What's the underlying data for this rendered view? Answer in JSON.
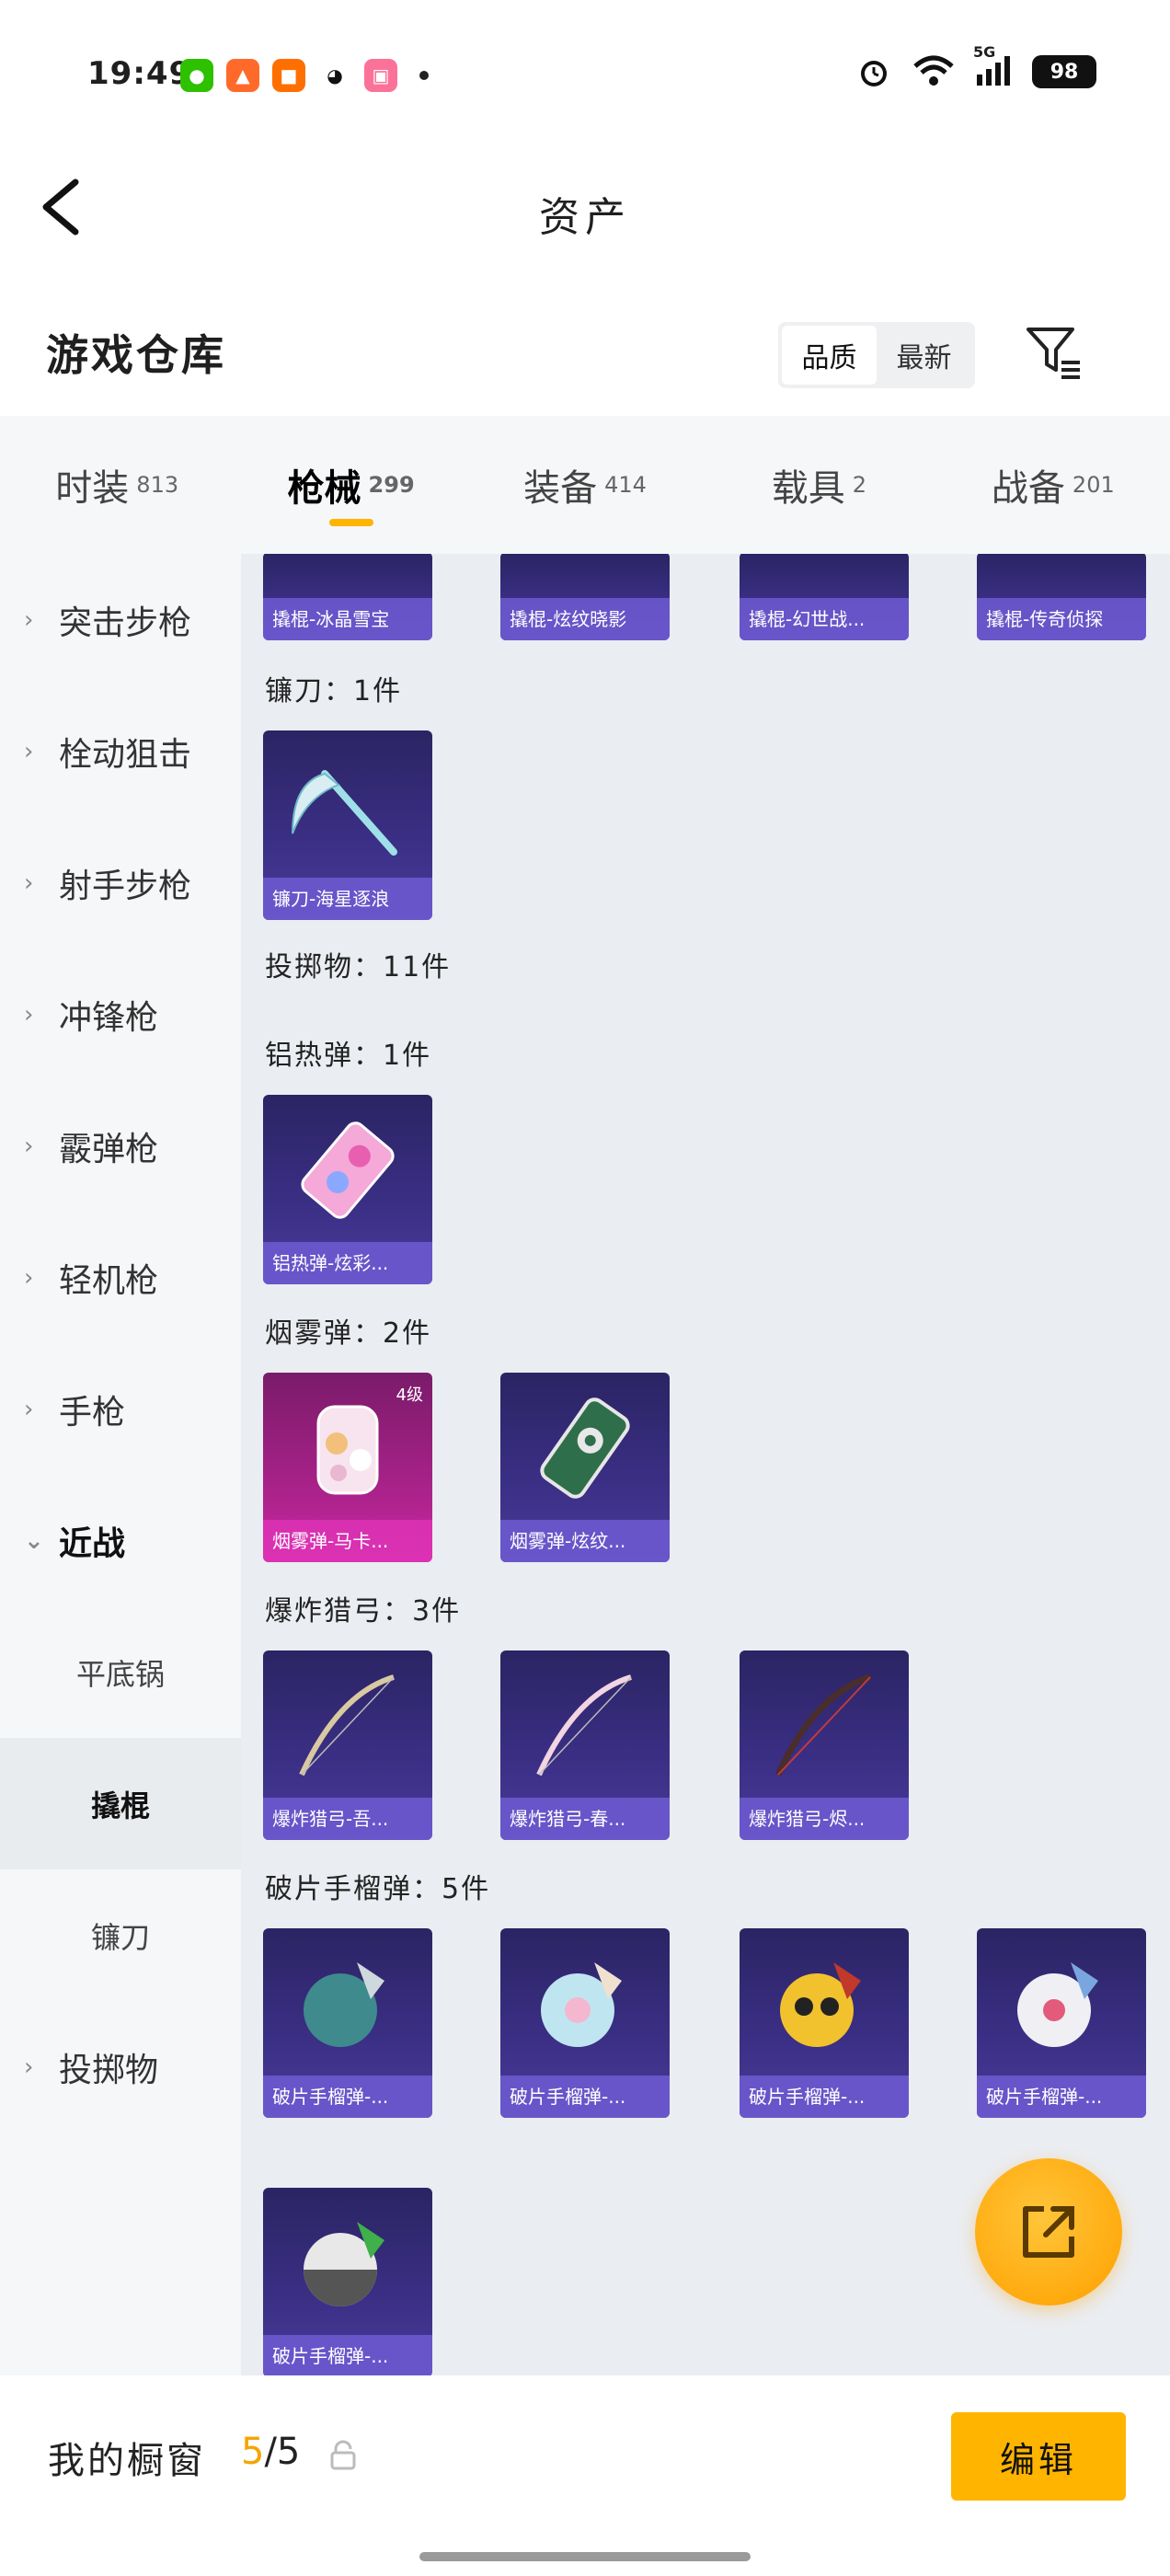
{
  "status_bar": {
    "time": "19:49",
    "battery": "98",
    "network": "5G"
  },
  "nav": {
    "title": "资产"
  },
  "header": {
    "title": "游戏仓库",
    "sort_options": [
      "品质",
      "最新"
    ],
    "active_sort": "品质"
  },
  "tabs": [
    {
      "label": "时装",
      "count": "813"
    },
    {
      "label": "枪械",
      "count": "299"
    },
    {
      "label": "装备",
      "count": "414"
    },
    {
      "label": "载具",
      "count": "2"
    },
    {
      "label": "战备",
      "count": "201"
    }
  ],
  "active_tab": "枪械",
  "sidebar": {
    "items": [
      {
        "label": "突击步枪"
      },
      {
        "label": "栓动狙击"
      },
      {
        "label": "射手步枪"
      },
      {
        "label": "冲锋枪"
      },
      {
        "label": "霰弹枪"
      },
      {
        "label": "轻机枪"
      },
      {
        "label": "手枪"
      },
      {
        "label": "近战"
      }
    ],
    "subitems": [
      {
        "label": "平底锅"
      },
      {
        "label": "撬棍"
      },
      {
        "label": "镰刀"
      }
    ],
    "last_item": {
      "label": "投掷物"
    },
    "selected": "撬棍"
  },
  "content": {
    "top_row_labels": [
      "撬棍-冰晶雪宝",
      "撬棍-炫纹晓影",
      "撬棍-幻世战...",
      "撬棍-传奇侦探"
    ],
    "sections": [
      {
        "title": "镰刀：1件",
        "items": [
          {
            "label": "镰刀-海星逐浪"
          }
        ]
      },
      {
        "title": "投掷物：11件",
        "items": []
      },
      {
        "title": "铝热弹：1件",
        "items": [
          {
            "label": "铝热弹-炫彩..."
          }
        ]
      },
      {
        "title": "烟雾弹：2件",
        "items": [
          {
            "label": "烟雾弹-马卡...",
            "badge": "4级"
          },
          {
            "label": "烟雾弹-炫纹..."
          }
        ]
      },
      {
        "title": "爆炸猎弓：3件",
        "items": [
          {
            "label": "爆炸猎弓-吾..."
          },
          {
            "label": "爆炸猎弓-春..."
          },
          {
            "label": "爆炸猎弓-烬..."
          }
        ]
      },
      {
        "title": "破片手榴弹：5件",
        "items": [
          {
            "label": "破片手榴弹-..."
          },
          {
            "label": "破片手榴弹-..."
          },
          {
            "label": "破片手榴弹-..."
          },
          {
            "label": "破片手榴弹-..."
          },
          {
            "label": "破片手榴弹-..."
          }
        ]
      }
    ]
  },
  "bottom_bar": {
    "label": "我的橱窗",
    "current": "5",
    "total": "/5",
    "edit_label": "编辑"
  },
  "colors": {
    "accent": "#ffb400",
    "card_bg": "#2f2770",
    "card_label": "#6e5ad2",
    "card_pink": "#d42aa8"
  }
}
